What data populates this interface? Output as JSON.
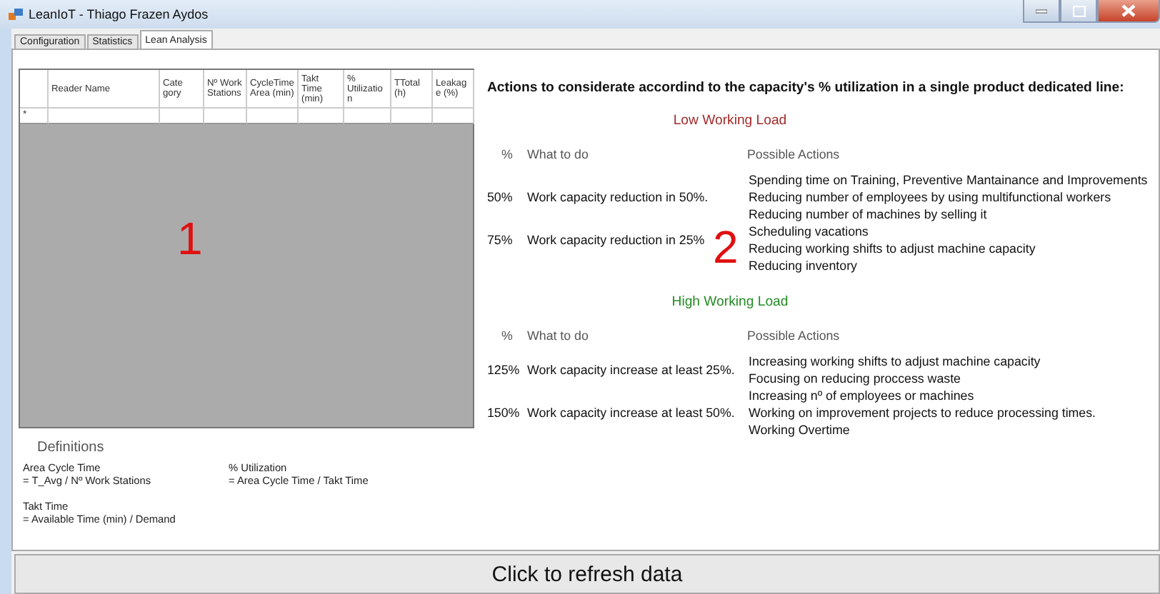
{
  "window": {
    "title": "LeanIoT - Thiago Frazen Aydos"
  },
  "tabs": [
    {
      "label": "Configuration",
      "selected": false
    },
    {
      "label": "Statistics",
      "selected": false
    },
    {
      "label": "Lean Analysis",
      "selected": true
    }
  ],
  "grid": {
    "columns": [
      "Reader Name",
      "Cate gory",
      "Nº Work Stations",
      "CycleTime Area (min)",
      "Takt Time (min)",
      "% Utilization",
      "TTotal (h)",
      "Leakage (%)"
    ],
    "new_row_marker": "*"
  },
  "annotations": [
    "1",
    "2"
  ],
  "definitions": {
    "title": "Definitions",
    "items": [
      {
        "name": "Area Cycle Time",
        "formula": "= T_Avg /  Nº Work Stations"
      },
      {
        "name": "% Utilization",
        "formula": "= Area Cycle Time /  Takt Time"
      },
      {
        "name": "Takt Time",
        "formula": "= Available Time (min) /  Demand"
      }
    ]
  },
  "actions": {
    "heading": "Actions to considerate accordind to the capacity's % utilization in a single product dedicated line:",
    "sections": [
      {
        "title": "Low Working Load",
        "color": "#a52a2a",
        "headers": [
          "%",
          "What to do",
          "Possible Actions"
        ],
        "rows": [
          {
            "percent": "50%",
            "what": "Work capacity reduction in 50%."
          },
          {
            "percent": "75%",
            "what": "Work capacity reduction in 25%"
          }
        ],
        "actions": [
          "Spending time on Training, Preventive Mantainance and Improvements",
          "Reducing number of employees by using multifunctional workers",
          "Reducing number of machines by selling it",
          "Scheduling vacations",
          "Reducing working shifts to adjust machine capacity",
          "Reducing inventory"
        ]
      },
      {
        "title": "High Working Load",
        "color": "#228b22",
        "headers": [
          "%",
          "What to do",
          "Possible Actions"
        ],
        "rows": [
          {
            "percent": "125%",
            "what": "Work capacity increase at least 25%."
          },
          {
            "percent": "150%",
            "what": "Work capacity increase at least 50%."
          }
        ],
        "actions": [
          "Increasing working shifts to adjust machine capacity",
          "Focusing on reducing proccess waste",
          "Increasing nº of employees or machines",
          "Working on improvement projects to reduce processing times.",
          "Working Overtime"
        ]
      }
    ]
  },
  "refresh_button": "Click to refresh data"
}
